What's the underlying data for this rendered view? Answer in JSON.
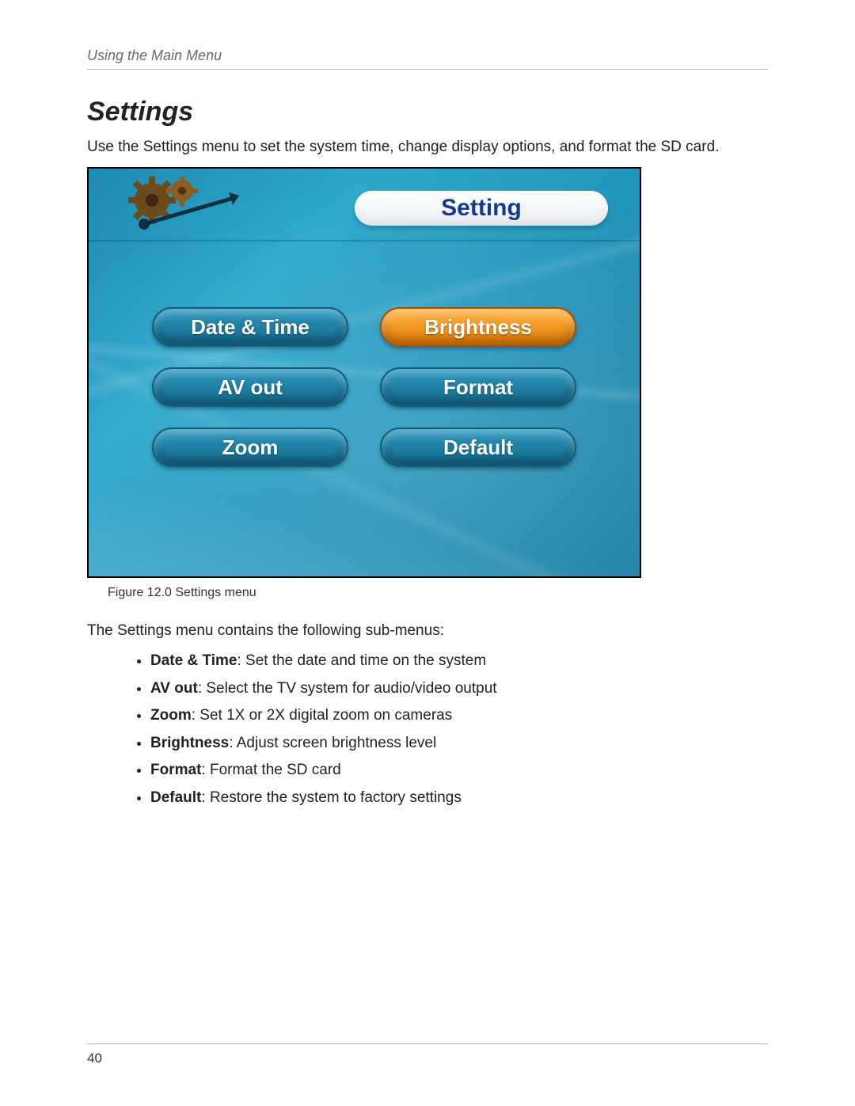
{
  "running_head": "Using the Main Menu",
  "section_title": "Settings",
  "intro": "Use the Settings menu to set the system time, change display options, and format the SD card.",
  "screenshot": {
    "title_pill": "Setting",
    "header_icon": "gears-wrench-icon",
    "buttons": {
      "date_time": {
        "label": "Date & Time",
        "selected": false
      },
      "brightness": {
        "label": "Brightness",
        "selected": true
      },
      "av_out": {
        "label": "AV out",
        "selected": false
      },
      "format": {
        "label": "Format",
        "selected": false
      },
      "zoom": {
        "label": "Zoom",
        "selected": false
      },
      "default": {
        "label": "Default",
        "selected": false
      }
    }
  },
  "figcap": "Figure 12.0 Settings menu",
  "subintro": "The Settings menu contains the following sub-menus:",
  "bullets": [
    {
      "term": "Date & Time",
      "desc": ": Set the date and time on the system"
    },
    {
      "term": "AV out",
      "desc": ": Select the TV system for audio/video output"
    },
    {
      "term": "Zoom",
      "desc": ": Set 1X or 2X digital zoom on cameras"
    },
    {
      "term": "Brightness",
      "desc": ": Adjust screen brightness level"
    },
    {
      "term": "Format",
      "desc": ": Format the SD card"
    },
    {
      "term": "Default",
      "desc": ": Restore the system to factory settings"
    }
  ],
  "page_number": "40"
}
